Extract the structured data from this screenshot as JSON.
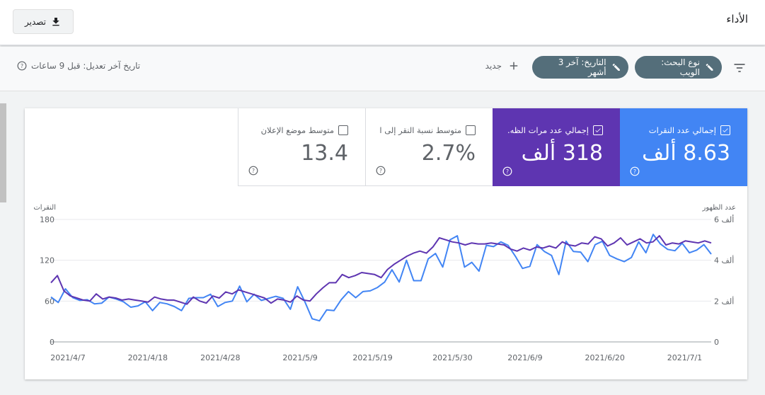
{
  "header": {
    "title": "الأداء",
    "export_label": "تصدير"
  },
  "filters": {
    "search_type_label": "نوع البحث: الويب",
    "date_label": "التاريخ: آخر 3 أشهر",
    "new_label": "جديد",
    "last_updated": "تاريخ آخر تعديل: قبل 9 ساعات"
  },
  "metrics": [
    {
      "label": "إجمالي عدد النقرات",
      "value": "8.63 ألف",
      "checked": true,
      "color": "#4285f4"
    },
    {
      "label": "إجمالي عدد مرات الظه...",
      "value": "318 ألف",
      "checked": true,
      "color": "#5e35b1"
    },
    {
      "label": "متوسط نسبة النقر إلى ا...",
      "value": "2.7%",
      "checked": false
    },
    {
      "label": "متوسط موضع الإعلان",
      "value": "13.4",
      "checked": false
    }
  ],
  "chart_data": {
    "type": "line",
    "left_axis": {
      "label": "النقرات",
      "ticks": [
        "0",
        "60",
        "120",
        "180"
      ],
      "ylim": [
        0,
        180
      ]
    },
    "right_axis": {
      "label": "عدد الظهور",
      "ticks": [
        "0",
        "2 ألف",
        "4 ألف",
        "6 ألف"
      ],
      "ylim": [
        0,
        6000
      ]
    },
    "x_tick_labels": [
      "2021/4/7",
      "2021/4/18",
      "2021/4/28",
      "2021/5/9",
      "2021/5/19",
      "2021/5/30",
      "2021/6/9",
      "2021/6/20",
      "2021/7/1"
    ],
    "x_tick_indices": [
      0,
      11,
      21,
      32,
      42,
      53,
      63,
      74,
      85
    ],
    "grid": true,
    "series": [
      {
        "name": "إجمالي عدد النقرات",
        "axis": "left",
        "color": "#4285f4",
        "values": [
          66,
          58,
          78,
          65,
          61,
          62,
          56,
          57,
          66,
          63,
          59,
          51,
          53,
          59,
          46,
          58,
          56,
          52,
          46,
          64,
          65,
          65,
          70,
          52,
          58,
          60,
          82,
          59,
          70,
          61,
          64,
          67,
          64,
          48,
          81,
          59,
          34,
          31,
          47,
          46,
          62,
          74,
          65,
          74,
          75,
          80,
          88,
          106,
          88,
          120,
          90,
          90,
          122,
          130,
          110,
          150,
          156,
          110,
          117,
          104,
          142,
          140,
          147,
          142,
          126,
          108,
          111,
          143,
          133,
          127,
          99,
          148,
          133,
          132,
          118,
          143,
          148,
          127,
          122,
          118,
          124,
          147,
          131,
          158,
          144,
          136,
          134,
          145,
          131,
          135,
          143,
          129
        ]
      },
      {
        "name": "إجمالي عدد مرات الظهور",
        "axis": "right",
        "color": "#5e35b1",
        "values": [
          2900,
          3250,
          2500,
          2250,
          2150,
          2050,
          2000,
          2350,
          2100,
          2200,
          2150,
          2050,
          2100,
          2050,
          2000,
          1950,
          2200,
          2100,
          2050,
          2050,
          1950,
          1850,
          2200,
          2000,
          1900,
          2250,
          2150,
          2450,
          2350,
          2550,
          2450,
          2350,
          2250,
          2150,
          1900,
          2100,
          2050,
          1950,
          2250,
          2050,
          2000,
          2350,
          2650,
          2900,
          2900,
          3300,
          3150,
          3250,
          3400,
          3350,
          3300,
          3150,
          3550,
          3800,
          4000,
          4200,
          4350,
          4450,
          4350,
          4650,
          5100,
          5000,
          4900,
          4850,
          4750,
          4850,
          4800,
          4800,
          4850,
          4800,
          4750,
          4550,
          4450,
          4600,
          4500,
          4650,
          4600,
          4700,
          4600,
          4900,
          4750,
          4700,
          4850,
          4800,
          5150,
          5050,
          4700,
          4850,
          5100,
          4750,
          4900,
          5050,
          4850,
          4900,
          5200,
          4750,
          4850,
          4800,
          4950,
          4900,
          4850,
          4950,
          4850
        ]
      }
    ]
  }
}
